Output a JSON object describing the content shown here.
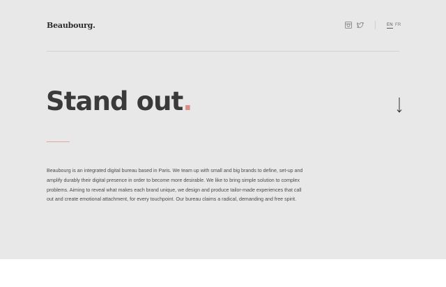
{
  "header": {
    "logo": "Beaubourg.",
    "social": [
      {
        "icon": "instagram-icon"
      },
      {
        "icon": "twitter-icon"
      }
    ],
    "languages": [
      {
        "label": "EN",
        "active": true
      },
      {
        "label": "FR",
        "active": false
      }
    ]
  },
  "hero": {
    "headline_text": "Stand out",
    "headline_dot": ".",
    "scroll_icon": "arrow-down-icon",
    "intro": "Beaubourg is an integrated digital bureau based in Paris. We team up with small and big brands to define, set-up and amplify durably their digital presence in order to become more desirable. We like to bring simple solution to complex problems. Aiming to reveal what makes each brand unique, we design and produce tailor-made experiences that call out and create emotional attachment, for every touchpoint. Our bureau claims a radical, demanding and free spirit."
  },
  "colors": {
    "background": "#e8e8e8",
    "accent": "#d98e86",
    "text": "#3a3a3a"
  }
}
